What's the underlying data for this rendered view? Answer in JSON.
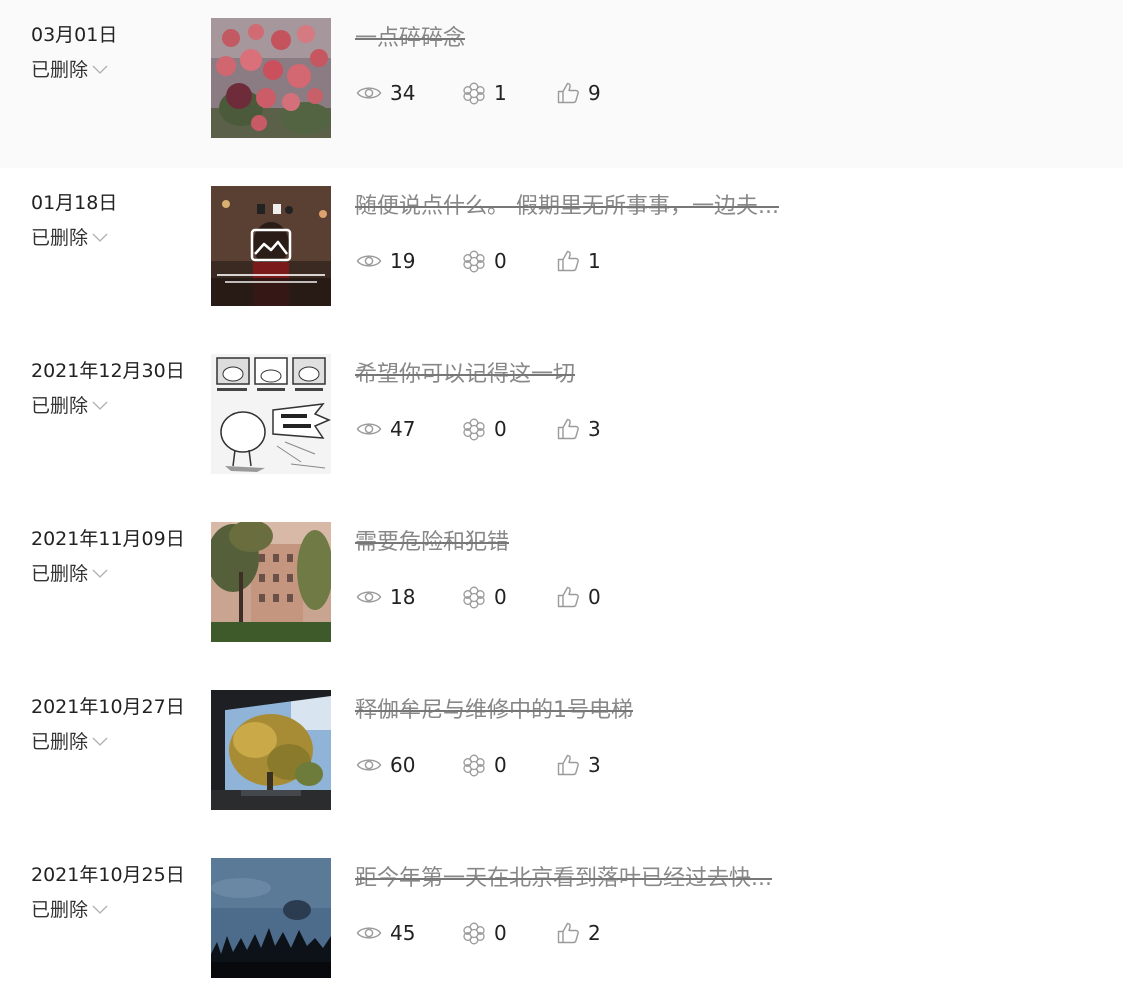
{
  "posts": [
    {
      "date": "03月01日",
      "status": "已删除",
      "title": "一点碎碎念",
      "views": "34",
      "comments": "1",
      "likes": "9",
      "thumb": "roses"
    },
    {
      "date": "01月18日",
      "status": "已删除",
      "title": "随便说点什么。 假期里无所事事，一边夫...",
      "views": "19",
      "comments": "0",
      "likes": "1",
      "thumb": "video"
    },
    {
      "date": "2021年12月30日",
      "status": "已删除",
      "title": "希望你可以记得这一切",
      "views": "47",
      "comments": "0",
      "likes": "3",
      "thumb": "comic"
    },
    {
      "date": "2021年11月09日",
      "status": "已删除",
      "title": "需要危险和犯错",
      "views": "18",
      "comments": "0",
      "likes": "0",
      "thumb": "building"
    },
    {
      "date": "2021年10月27日",
      "status": "已删除",
      "title": "释伽牟尼与维修中的1号电梯",
      "views": "60",
      "comments": "0",
      "likes": "3",
      "thumb": "tree"
    },
    {
      "date": "2021年10月25日",
      "status": "已删除",
      "title": "距今年第一天在北京看到落叶已经过去快...",
      "views": "45",
      "comments": "0",
      "likes": "2",
      "thumb": "sky"
    }
  ],
  "icons": {
    "status_toggle": "chevron-down-icon",
    "views": "eye-icon",
    "comments": "comment-icon",
    "likes": "thumbs-up-icon"
  }
}
